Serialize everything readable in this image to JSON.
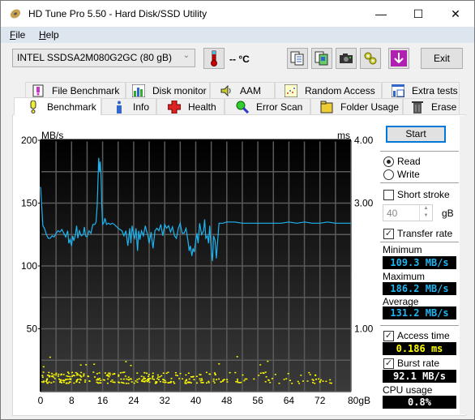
{
  "window": {
    "title": "HD Tune Pro 5.50 - Hard Disk/SSD Utility",
    "controls": {
      "minimize": "—",
      "maximize": "☐",
      "close": "✕"
    }
  },
  "menu": [
    {
      "label": "File",
      "accel": "F",
      "rest": "ile"
    },
    {
      "label": "Help",
      "accel": "H",
      "rest": "elp"
    }
  ],
  "toolbar": {
    "drive": "INTEL SSDSA2M080G2GC (80 gB)",
    "temperature": "-- °C",
    "exit_label": "Exit",
    "buttons": [
      "copy-text-icon",
      "copy-image-icon",
      "screenshot-camera-icon",
      "options-gear-icon",
      "save-download-icon"
    ]
  },
  "tabs": {
    "row1": [
      {
        "label": "File Benchmark",
        "icon": "file-benchmark-icon"
      },
      {
        "label": "Disk monitor",
        "icon": "disk-monitor-icon"
      },
      {
        "label": "AAM",
        "icon": "speaker-icon"
      },
      {
        "label": "Random Access",
        "icon": "random-access-icon"
      },
      {
        "label": "Extra tests",
        "icon": "extra-tests-icon"
      }
    ],
    "row2": [
      {
        "label": "Benchmark",
        "icon": "exclamation-icon",
        "active": true
      },
      {
        "label": "Info",
        "icon": "info-icon"
      },
      {
        "label": "Health",
        "icon": "health-cross-icon"
      },
      {
        "label": "Error Scan",
        "icon": "magnifier-icon"
      },
      {
        "label": "Folder Usage",
        "icon": "folder-icon"
      },
      {
        "label": "Erase",
        "icon": "trash-icon"
      }
    ]
  },
  "side": {
    "start_label": "Start",
    "read_label": "Read",
    "write_label": "Write",
    "read_selected": true,
    "short_stroke_label": "Short stroke",
    "short_stroke_checked": false,
    "short_stroke_value": "40",
    "short_stroke_unit": "gB",
    "transfer_rate_label": "Transfer rate",
    "transfer_rate_checked": true,
    "minimum_label": "Minimum",
    "minimum_value": "109.3 MB/s",
    "maximum_label": "Maximum",
    "maximum_value": "186.2 MB/s",
    "average_label": "Average",
    "average_value": "131.2 MB/s",
    "access_time_label": "Access time",
    "access_time_checked": true,
    "access_time_value": "0.186 ms",
    "burst_rate_label": "Burst rate",
    "burst_rate_checked": true,
    "burst_rate_value": "92.1 MB/s",
    "cpu_usage_label": "CPU usage",
    "cpu_usage_value": "0.8%"
  },
  "colors": {
    "transfer_line": "#1eb4f0",
    "access_dots": "#ffff00",
    "value_blue": "#1eb4f0",
    "value_yellow": "#ffff00",
    "value_white": "#ffffff",
    "start_border": "#0078d7"
  },
  "chart_data": {
    "type": "line",
    "title": "",
    "xlabel": "gB",
    "ylabel_left": "MB/s",
    "ylabel_right": "ms",
    "xlim": [
      0,
      80
    ],
    "ylim_left": [
      0,
      200
    ],
    "ylim_right": [
      0,
      4
    ],
    "x_ticks": [
      "0",
      "8",
      "16",
      "24",
      "32",
      "40",
      "48",
      "56",
      "64",
      "72",
      "80gB"
    ],
    "y_ticks_left": [
      "200",
      "150",
      "100",
      "50"
    ],
    "y_ticks_right": [
      "4.00",
      "3.00",
      "1.00"
    ],
    "grid": true,
    "series": [
      {
        "name": "Transfer rate (MB/s)",
        "x": [
          0,
          0.3,
          0.6,
          1,
          1.5,
          2,
          2.5,
          3,
          3.5,
          4,
          4.5,
          5,
          5.5,
          6,
          6.5,
          7,
          7.3,
          7.6,
          8,
          8.3,
          8.6,
          9,
          9.3,
          9.6,
          10,
          10.5,
          11,
          11.3,
          11.6,
          12,
          12.5,
          13,
          13.5,
          14,
          14.3,
          14.6,
          15,
          15.2,
          15.4,
          15.6,
          15.8,
          16,
          16.3,
          16.6,
          17,
          17.5,
          18,
          18.5,
          19,
          20,
          21,
          21.5,
          22,
          22.5,
          23,
          23.3,
          23.6,
          24,
          24.3,
          24.6,
          25,
          25.3,
          25.6,
          26,
          26.5,
          27,
          27.3,
          27.6,
          28,
          28.5,
          29,
          29.5,
          30,
          30.5,
          31,
          31.5,
          32,
          32.5,
          33,
          33.5,
          34,
          34.5,
          35,
          35.5,
          36,
          36.5,
          37,
          37.5,
          38,
          38.3,
          38.6,
          39,
          39.3,
          39.6,
          40,
          40.3,
          40.6,
          41,
          41.5,
          42,
          42.3,
          42.6,
          43,
          43.3,
          43.6,
          44,
          44.3,
          44.6,
          45,
          45.3,
          45.6,
          46,
          47,
          48,
          50,
          52,
          54,
          56,
          58,
          60,
          62,
          64,
          66,
          68,
          70,
          72,
          74,
          76,
          78,
          80
        ],
        "values": [
          163,
          148,
          132,
          130,
          125,
          122,
          122,
          124,
          123,
          126,
          128,
          127,
          129,
          126,
          123,
          128,
          118,
          121,
          116,
          124,
          120,
          125,
          132,
          122,
          128,
          124,
          125,
          131,
          124,
          123,
          128,
          126,
          133,
          133,
          135,
          148,
          186,
          175,
          183,
          170,
          148,
          133,
          134,
          138,
          133,
          134,
          133,
          134,
          133,
          130,
          128,
          124,
          128,
          116,
          130,
          118,
          132,
          124,
          122,
          130,
          112,
          128,
          121,
          128,
          124,
          132,
          128,
          125,
          118,
          127,
          114,
          128,
          130,
          128,
          133,
          124,
          133,
          130,
          132,
          127,
          131,
          124,
          122,
          130,
          134,
          126,
          126,
          130,
          120,
          112,
          116,
          108,
          114,
          111,
          120,
          126,
          118,
          134,
          125,
          128,
          137,
          122,
          124,
          118,
          132,
          112,
          104,
          124,
          120,
          106,
          118,
          134,
          134,
          135,
          135,
          134,
          134,
          134,
          134,
          134,
          134,
          135,
          134,
          135,
          134,
          134,
          135,
          134,
          134,
          134
        ]
      },
      {
        "name": "Access time (ms)",
        "note": "scattered yellow dots, mostly between 0.1 and 0.35 ms across 0-76 gB, a few outliers up to ~0.6 ms",
        "range_ms": [
          0.1,
          0.6
        ]
      }
    ]
  }
}
